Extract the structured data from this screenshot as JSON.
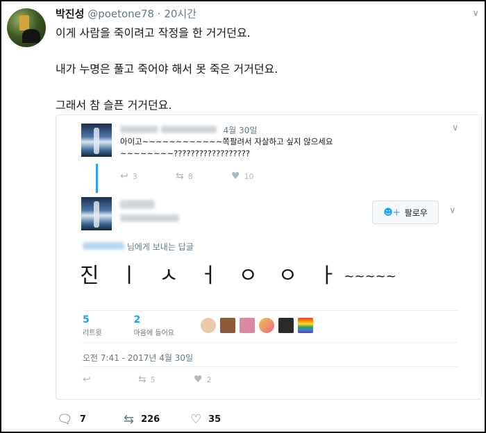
{
  "tweet": {
    "display_name": "박진성",
    "handle": "@poetone78",
    "separator": "·",
    "time": "20시간",
    "lines": [
      "이게 사람을 죽이려고 작정을 한 거거던요.",
      "",
      "내가 누명은 풀고 죽어야 해서 못 죽은 거거던요.",
      "",
      "그래서 참 슬픈 거거던요."
    ],
    "actions": {
      "reply_count": "7",
      "retweet_count": "226",
      "like_count": "35"
    }
  },
  "quoted": {
    "reply1": {
      "date": "4월 30일",
      "text": "아이고~~~~~~~~~~~~쪽팔려서 자살하고 싶지 않으세요\n~~~~~~~~??????????????????",
      "reply_count": "3",
      "retweet_count": "8",
      "like_count": "10"
    },
    "main": {
      "follow_label": "팔로우",
      "reply_to_suffix": "님에게 보내는 답글",
      "big_text": "진 ㅣ ㅅ ㅓ ㅇ ㅇ ㅏ",
      "big_tilde": "~~~~~",
      "retweets": {
        "count": "5",
        "label": "리트윗"
      },
      "likes": {
        "count": "2",
        "label": "마음에 들어요"
      },
      "timestamp": "오전 7:41 - 2017년 4월 30일",
      "retweet_count": "5",
      "like_count": "2"
    }
  },
  "colors": {
    "accent": "#1da1f2",
    "thread": "#2aa3ef",
    "muted": "#657786"
  }
}
